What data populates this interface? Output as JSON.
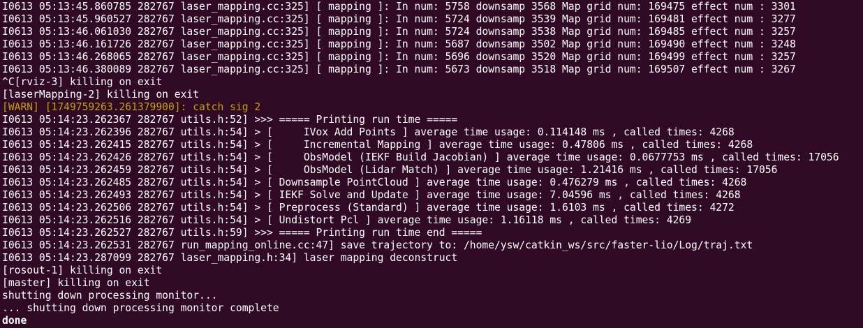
{
  "terminal": {
    "colors": {
      "background": "#300a24",
      "text": "#ffffff",
      "warn": "#c4a000"
    },
    "lines": [
      {
        "text": "I0613 05:13:45.860785 282767 laser_mapping.cc:325] [ mapping ]: In num: 5758 downsamp 3568 Map grid num: 169475 effect num : 3301",
        "style": "normal"
      },
      {
        "text": "I0613 05:13:45.960527 282767 laser_mapping.cc:325] [ mapping ]: In num: 5724 downsamp 3539 Map grid num: 169481 effect num : 3277",
        "style": "normal"
      },
      {
        "text": "I0613 05:13:46.061030 282767 laser_mapping.cc:325] [ mapping ]: In num: 5724 downsamp 3538 Map grid num: 169485 effect num : 3257",
        "style": "normal"
      },
      {
        "text": "I0613 05:13:46.161726 282767 laser_mapping.cc:325] [ mapping ]: In num: 5687 downsamp 3502 Map grid num: 169490 effect num : 3248",
        "style": "normal"
      },
      {
        "text": "I0613 05:13:46.268065 282767 laser_mapping.cc:325] [ mapping ]: In num: 5696 downsamp 3520 Map grid num: 169499 effect num : 3257",
        "style": "normal"
      },
      {
        "text": "I0613 05:13:46.380089 282767 laser_mapping.cc:325] [ mapping ]: In num: 5673 downsamp 3518 Map grid num: 169507 effect num : 3267",
        "style": "normal"
      },
      {
        "text": "^C[rviz-3] killing on exit",
        "style": "normal"
      },
      {
        "text": "[laserMapping-2] killing on exit",
        "style": "normal"
      },
      {
        "text": "[WARN] [1749759263.261379900]: catch sig 2",
        "style": "warn"
      },
      {
        "text": "I0613 05:14:23.262367 282767 utils.h:52] >>> ===== Printing run time =====",
        "style": "normal"
      },
      {
        "text": "I0613 05:14:23.262396 282767 utils.h:54] > [     IVox Add Points ] average time usage: 0.114148 ms , called times: 4268",
        "style": "normal"
      },
      {
        "text": "I0613 05:14:23.262415 282767 utils.h:54] > [     Incremental Mapping ] average time usage: 0.47806 ms , called times: 4268",
        "style": "normal"
      },
      {
        "text": "I0613 05:14:23.262426 282767 utils.h:54] > [     ObsModel (IEKF Build Jacobian) ] average time usage: 0.0677753 ms , called times: 17056",
        "style": "normal"
      },
      {
        "text": "I0613 05:14:23.262459 282767 utils.h:54] > [     ObsModel (Lidar Match) ] average time usage: 1.21416 ms , called times: 17056",
        "style": "normal"
      },
      {
        "text": "I0613 05:14:23.262485 282767 utils.h:54] > [ Downsample PointCloud ] average time usage: 0.476279 ms , called times: 4268",
        "style": "normal"
      },
      {
        "text": "I0613 05:14:23.262493 282767 utils.h:54] > [ IEKF Solve and Update ] average time usage: 7.04596 ms , called times: 4268",
        "style": "normal"
      },
      {
        "text": "I0613 05:14:23.262506 282767 utils.h:54] > [ Preprocess (Standard) ] average time usage: 1.6103 ms , called times: 4272",
        "style": "normal"
      },
      {
        "text": "I0613 05:14:23.262516 282767 utils.h:54] > [ Undistort Pcl ] average time usage: 1.16118 ms , called times: 4269",
        "style": "normal"
      },
      {
        "text": "I0613 05:14:23.262527 282767 utils.h:59] >>> ===== Printing run time end =====",
        "style": "normal"
      },
      {
        "text": "I0613 05:14:23.262531 282767 run_mapping_online.cc:47] save trajectory to: /home/ysw/catkin_ws/src/faster-lio/Log/traj.txt",
        "style": "normal"
      },
      {
        "text": "I0613 05:14:23.287099 282767 laser_mapping.h:34] laser mapping deconstruct",
        "style": "normal"
      },
      {
        "text": "[rosout-1] killing on exit",
        "style": "normal"
      },
      {
        "text": "[master] killing on exit",
        "style": "normal"
      },
      {
        "text": "shutting down processing monitor...",
        "style": "normal"
      },
      {
        "text": "... shutting down processing monitor complete",
        "style": "normal"
      },
      {
        "text": "done",
        "style": "bold"
      }
    ]
  }
}
